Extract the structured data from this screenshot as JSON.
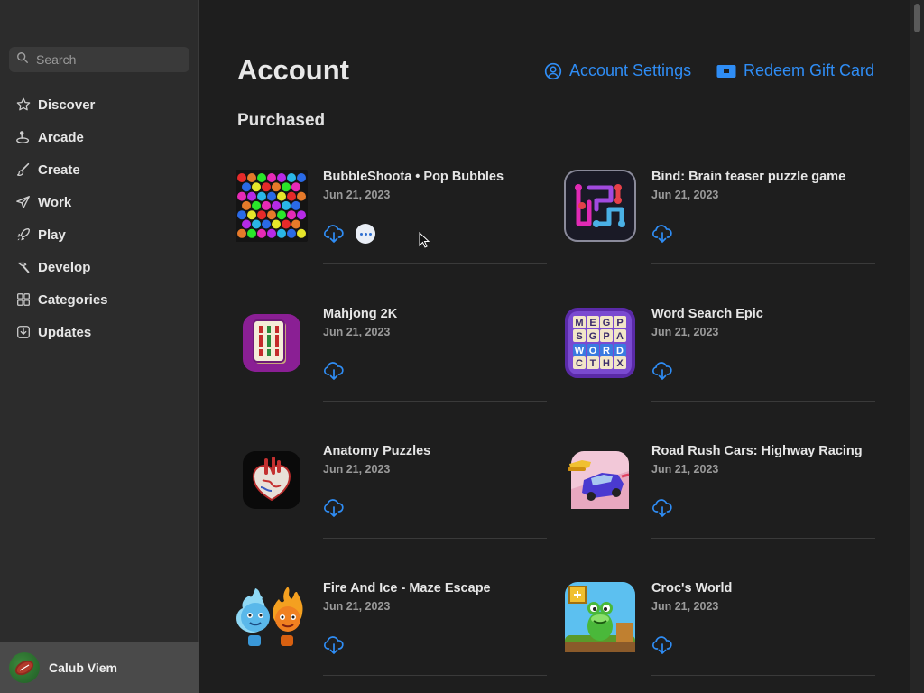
{
  "sidebar": {
    "search_placeholder": "Search",
    "items": [
      {
        "label": "Discover",
        "icon": "star-icon"
      },
      {
        "label": "Arcade",
        "icon": "joystick-icon"
      },
      {
        "label": "Create",
        "icon": "paintbrush-icon"
      },
      {
        "label": "Work",
        "icon": "paperplane-icon"
      },
      {
        "label": "Play",
        "icon": "rocket-icon"
      },
      {
        "label": "Develop",
        "icon": "hammer-icon"
      },
      {
        "label": "Categories",
        "icon": "grid-icon"
      },
      {
        "label": "Updates",
        "icon": "download-icon"
      }
    ],
    "user_name": "Calub Viem"
  },
  "header": {
    "title": "Account",
    "account_settings": "Account Settings",
    "redeem": "Redeem Gift Card"
  },
  "section_title": "Purchased",
  "accent": "#2f8df5",
  "apps": [
    {
      "name": "BubbleShoota • Pop Bubbles",
      "date": "Jun 21, 2023"
    },
    {
      "name": "Bind: Brain teaser puzzle game",
      "date": "Jun 21, 2023"
    },
    {
      "name": "Mahjong 2K",
      "date": "Jun 21, 2023"
    },
    {
      "name": "Word Search Epic",
      "date": "Jun 21, 2023"
    },
    {
      "name": "Anatomy Puzzles",
      "date": "Jun 21, 2023"
    },
    {
      "name": "Road Rush Cars: Highway Racing",
      "date": "Jun 21, 2023"
    },
    {
      "name": "Fire And Ice - Maze Escape",
      "date": "Jun 21, 2023"
    },
    {
      "name": "Croc's World",
      "date": "Jun 21, 2023"
    }
  ],
  "word_search_letters": [
    "M",
    "E",
    "G",
    "P",
    "S",
    "A",
    "W",
    "O",
    "R",
    "D",
    "C",
    "T",
    "H",
    "X"
  ]
}
